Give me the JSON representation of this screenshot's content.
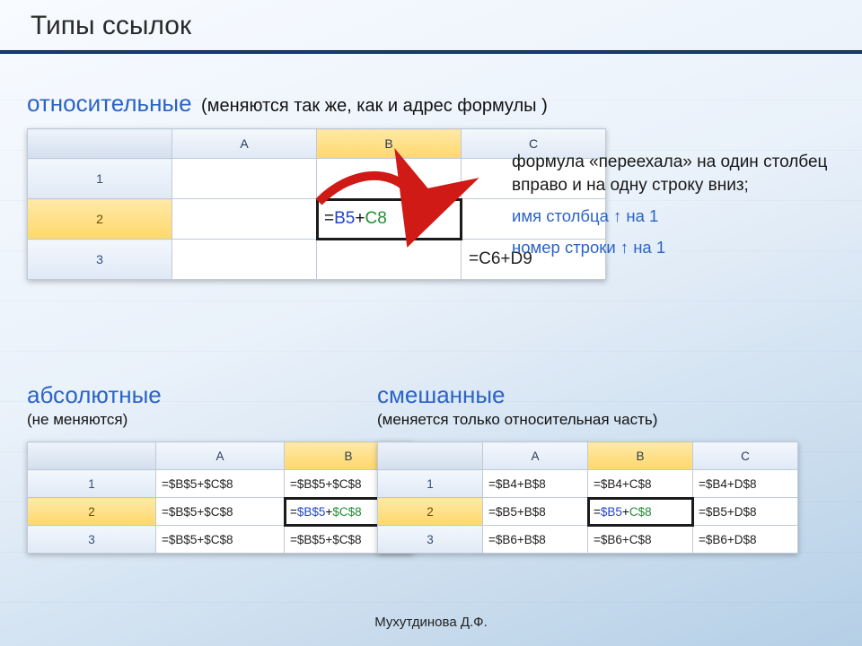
{
  "title": "Типы ссылок",
  "footer": "Мухутдинова Д.Ф.",
  "relative": {
    "heading": "относительные",
    "note": "(меняются так же, как и адрес формулы )",
    "columns": [
      "A",
      "B",
      "C"
    ],
    "rows": [
      "1",
      "2",
      "3"
    ],
    "formula_b2": {
      "full": "=B5+C8",
      "eq": "=",
      "a": "B5",
      "plus": "+",
      "b": "C8"
    },
    "formula_c3": {
      "full": "=C6+D9"
    },
    "side": {
      "line1": "формула «переехала» на один столбец вправо и на одну строку вниз;",
      "line2": "имя столбца ↑ на 1",
      "line3": "номер строки ↑ на 1"
    }
  },
  "absolute": {
    "heading": "абсолютные",
    "note": "(не меняются)",
    "columns": [
      "A",
      "B"
    ],
    "rows": [
      "1",
      "2",
      "3"
    ],
    "cells": {
      "A1": "=$B$5+$C$8",
      "B1": "=$B$5+$C$8",
      "A2": "=$B$5+$C$8",
      "B2": {
        "eq": "=",
        "a": "$B$5",
        "plus": "+",
        "b": "$C$8"
      },
      "A3": "=$B$5+$C$8",
      "B3": "=$B$5+$C$8"
    }
  },
  "mixed": {
    "heading": "смешанные",
    "note": "(меняется только относительная часть)",
    "columns": [
      "A",
      "B",
      "C"
    ],
    "rows": [
      "1",
      "2",
      "3"
    ],
    "cells": {
      "A1": "=$B4+B$8",
      "B1": "=$B4+C$8",
      "C1": "=$B4+D$8",
      "A2": "=$B5+B$8",
      "B2": {
        "eq": "=",
        "a": "$B5",
        "plus": "+",
        "b": "C$8"
      },
      "C2": "=$B5+D$8",
      "A3": "=$B6+B$8",
      "B3": "=$B6+C$8",
      "C3": "=$B6+D$8"
    }
  }
}
